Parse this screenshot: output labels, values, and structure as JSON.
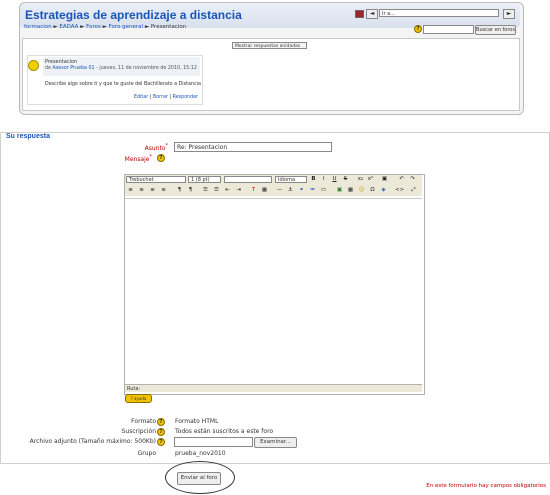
{
  "header": {
    "site_title": "Estrategias de aprendizaje a distancia",
    "jump_value": "Ir a...",
    "prev_label": "◄",
    "next_label": "►"
  },
  "breadcrumb": [
    "formacion",
    "EADAA",
    "Foros",
    "Foro general",
    "Presentacion"
  ],
  "search": {
    "help": "?",
    "button_label": "Buscar en foros"
  },
  "display_mode": "Mostrar respuestas anidadas",
  "post": {
    "subject": "Presentacion",
    "author_prefix": "de ",
    "author": "Asesor Prueba 01",
    "date": " - jueves, 11 de noviembre de 2010, 15:12",
    "body": "Describe algo sobre ti y que te guste del Bachillerato a Distancia",
    "commands": [
      "Editar",
      "Borrar",
      "Responder"
    ]
  },
  "reply": {
    "title": "Su respuesta",
    "subject_label": "Asunto",
    "subject_value": "Re: Presentacion",
    "message_label": "Mensaje",
    "required_mark": "*",
    "help": "?"
  },
  "editor": {
    "font": "Trebuchet",
    "size": "1 (8 pt)",
    "heading": "",
    "lang": "Idioma",
    "path_label": "Ruta:",
    "help_label": "? ayuda"
  },
  "fields": {
    "format_label": "Formato",
    "format_value": "Formato HTML",
    "subscription_label": "Suscripción",
    "subscription_value": "Todos están suscritos a este foro",
    "attachment_label": "Archivo adjunto (Tamaño máximo: 500Kb)",
    "browse_label": "Examinar...",
    "group_label": "Grupo",
    "group_value": "prueba_nov2010"
  },
  "submit_label": "Enviar al foro",
  "required_note": "En este formulario hay campos obligatorios",
  "colors": {
    "link": "#1a55b8",
    "required": "#c00000",
    "help": "#f2c200",
    "toolbar": "#ece9d8"
  }
}
